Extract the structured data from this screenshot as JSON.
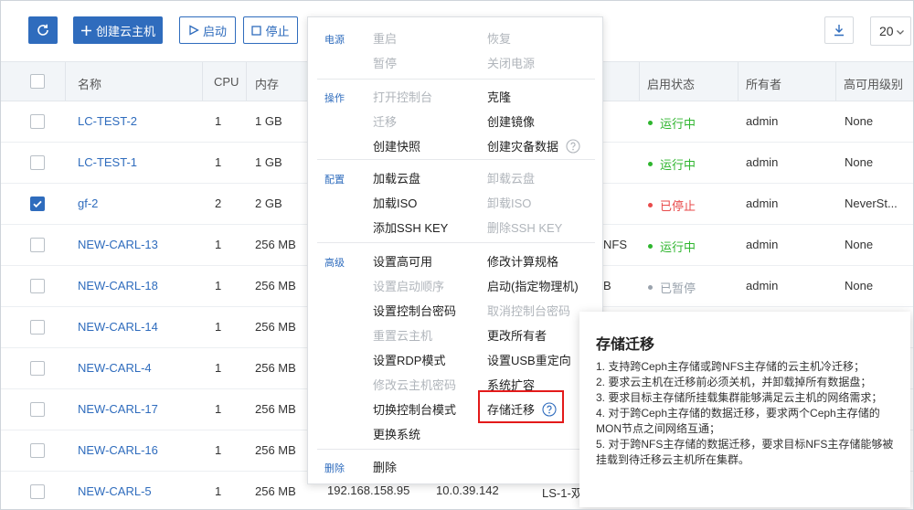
{
  "toolbar": {
    "create_label": "创建云主机",
    "start_label": "启动",
    "stop_label": "停止",
    "page_size": "20"
  },
  "table": {
    "headers": [
      "名称",
      "CPU",
      "内存",
      "启用状态",
      "所有者",
      "高可用级别"
    ],
    "rows": [
      {
        "name": "LC-TEST-2",
        "cpu": "1",
        "mem": "1 GB",
        "status": "运行中",
        "status_color": "#2eb52e",
        "owner": "admin",
        "ha": "None",
        "checked": false
      },
      {
        "name": "LC-TEST-1",
        "cpu": "1",
        "mem": "1 GB",
        "status": "运行中",
        "status_color": "#2eb52e",
        "owner": "admin",
        "ha": "None",
        "checked": false
      },
      {
        "name": "gf-2",
        "cpu": "2",
        "mem": "2 GB",
        "status": "已停止",
        "status_color": "#e84a4a",
        "owner": "admin",
        "ha": "NeverSt...",
        "checked": true
      },
      {
        "name": "NEW-CARL-13",
        "cpu": "1",
        "mem": "256 MB",
        "status": "运行中",
        "status_color": "#2eb52e",
        "owner": "admin",
        "ha": "None",
        "checked": false
      },
      {
        "name": "NEW-CARL-18",
        "cpu": "1",
        "mem": "256 MB",
        "status": "已暂停",
        "status_color": "#9aa3ad",
        "owner": "admin",
        "ha": "None",
        "checked": false
      },
      {
        "name": "NEW-CARL-14",
        "cpu": "1",
        "mem": "256 MB",
        "status": "",
        "status_color": "",
        "owner": "",
        "ha": "",
        "checked": false
      },
      {
        "name": "NEW-CARL-4",
        "cpu": "1",
        "mem": "256 MB",
        "status": "",
        "status_color": "",
        "owner": "",
        "ha": "",
        "checked": false
      },
      {
        "name": "NEW-CARL-17",
        "cpu": "1",
        "mem": "256 MB",
        "status": "",
        "status_color": "",
        "owner": "",
        "ha": "",
        "checked": false
      },
      {
        "name": "NEW-CARL-16",
        "cpu": "1",
        "mem": "256 MB",
        "status": "",
        "status_color": "",
        "owner": "",
        "ha": "",
        "checked": false
      },
      {
        "name": "NEW-CARL-5",
        "cpu": "1",
        "mem": "256 MB",
        "status": "",
        "status_color": "",
        "owner": "",
        "ha": "",
        "checked": false
      }
    ],
    "peek": {
      "row4_nfs": "NFS",
      "row5_b": "B",
      "last_ip1": "192.168.158.95",
      "last_ip2": "10.0.39.142",
      "last_host": "LS-1-双"
    }
  },
  "menu": {
    "sections": [
      {
        "label": "电源",
        "items": [
          {
            "text": "重启",
            "enabled": false
          },
          {
            "text": "恢复",
            "enabled": false
          },
          {
            "text": "暂停",
            "enabled": false
          },
          {
            "text": "关闭电源",
            "enabled": false
          }
        ]
      },
      {
        "label": "操作",
        "items": [
          {
            "text": "打开控制台",
            "enabled": false
          },
          {
            "text": "克隆",
            "enabled": true
          },
          {
            "text": "迁移",
            "enabled": false
          },
          {
            "text": "创建镜像",
            "enabled": true
          },
          {
            "text": "创建快照",
            "enabled": true
          },
          {
            "text": "创建灾备数据",
            "enabled": true,
            "help": true
          }
        ]
      },
      {
        "label": "配置",
        "items": [
          {
            "text": "加载云盘",
            "enabled": true
          },
          {
            "text": "卸载云盘",
            "enabled": false
          },
          {
            "text": "加载ISO",
            "enabled": true
          },
          {
            "text": "卸载ISO",
            "enabled": false
          },
          {
            "text": "添加SSH KEY",
            "enabled": true
          },
          {
            "text": "删除SSH KEY",
            "enabled": false
          }
        ]
      },
      {
        "label": "高级",
        "items": [
          {
            "text": "设置高可用",
            "enabled": true
          },
          {
            "text": "修改计算规格",
            "enabled": true
          },
          {
            "text": "设置启动顺序",
            "enabled": false
          },
          {
            "text": "启动(指定物理机)",
            "enabled": true
          },
          {
            "text": "设置控制台密码",
            "enabled": true
          },
          {
            "text": "取消控制台密码",
            "enabled": false
          },
          {
            "text": "重置云主机",
            "enabled": false
          },
          {
            "text": "更改所有者",
            "enabled": true
          },
          {
            "text": "设置RDP模式",
            "enabled": true
          },
          {
            "text": "设置USB重定向",
            "enabled": true
          },
          {
            "text": "修改云主机密码",
            "enabled": false
          },
          {
            "text": "系统扩容",
            "enabled": true
          },
          {
            "text": "切换控制台模式",
            "enabled": true
          },
          {
            "text": "存储迁移",
            "enabled": true,
            "help": true,
            "highlight": true
          },
          {
            "text": "更换系统",
            "enabled": true
          }
        ]
      },
      {
        "label": "删除",
        "items": [
          {
            "text": "删除",
            "enabled": true
          }
        ]
      }
    ]
  },
  "tooltip": {
    "title": "存储迁移",
    "lines": [
      "1. 支持跨Ceph主存储或跨NFS主存储的云主机冷迁移；",
      "2. 要求云主机在迁移前必须关机，并卸载掉所有数据盘；",
      "3. 要求目标主存储所挂载集群能够满足云主机的网络需求；",
      "4. 对于跨Ceph主存储的数据迁移，要求两个Ceph主存储的MON节点之间网络互通；",
      "5. 对于跨NFS主存储的数据迁移，要求目标NFS主存储能够被挂载到待迁移云主机所在集群。"
    ]
  },
  "colors": {
    "accent": "#2f6cbd",
    "running": "#2eb52e",
    "stopped": "#e84a4a",
    "paused": "#9aa3ad",
    "highlight": "#e31a1a"
  },
  "icons": [
    "refresh-icon",
    "plus-icon",
    "play-icon",
    "stop-icon",
    "download-icon",
    "chevron-down-icon",
    "help-circle-icon",
    "check-icon"
  ]
}
